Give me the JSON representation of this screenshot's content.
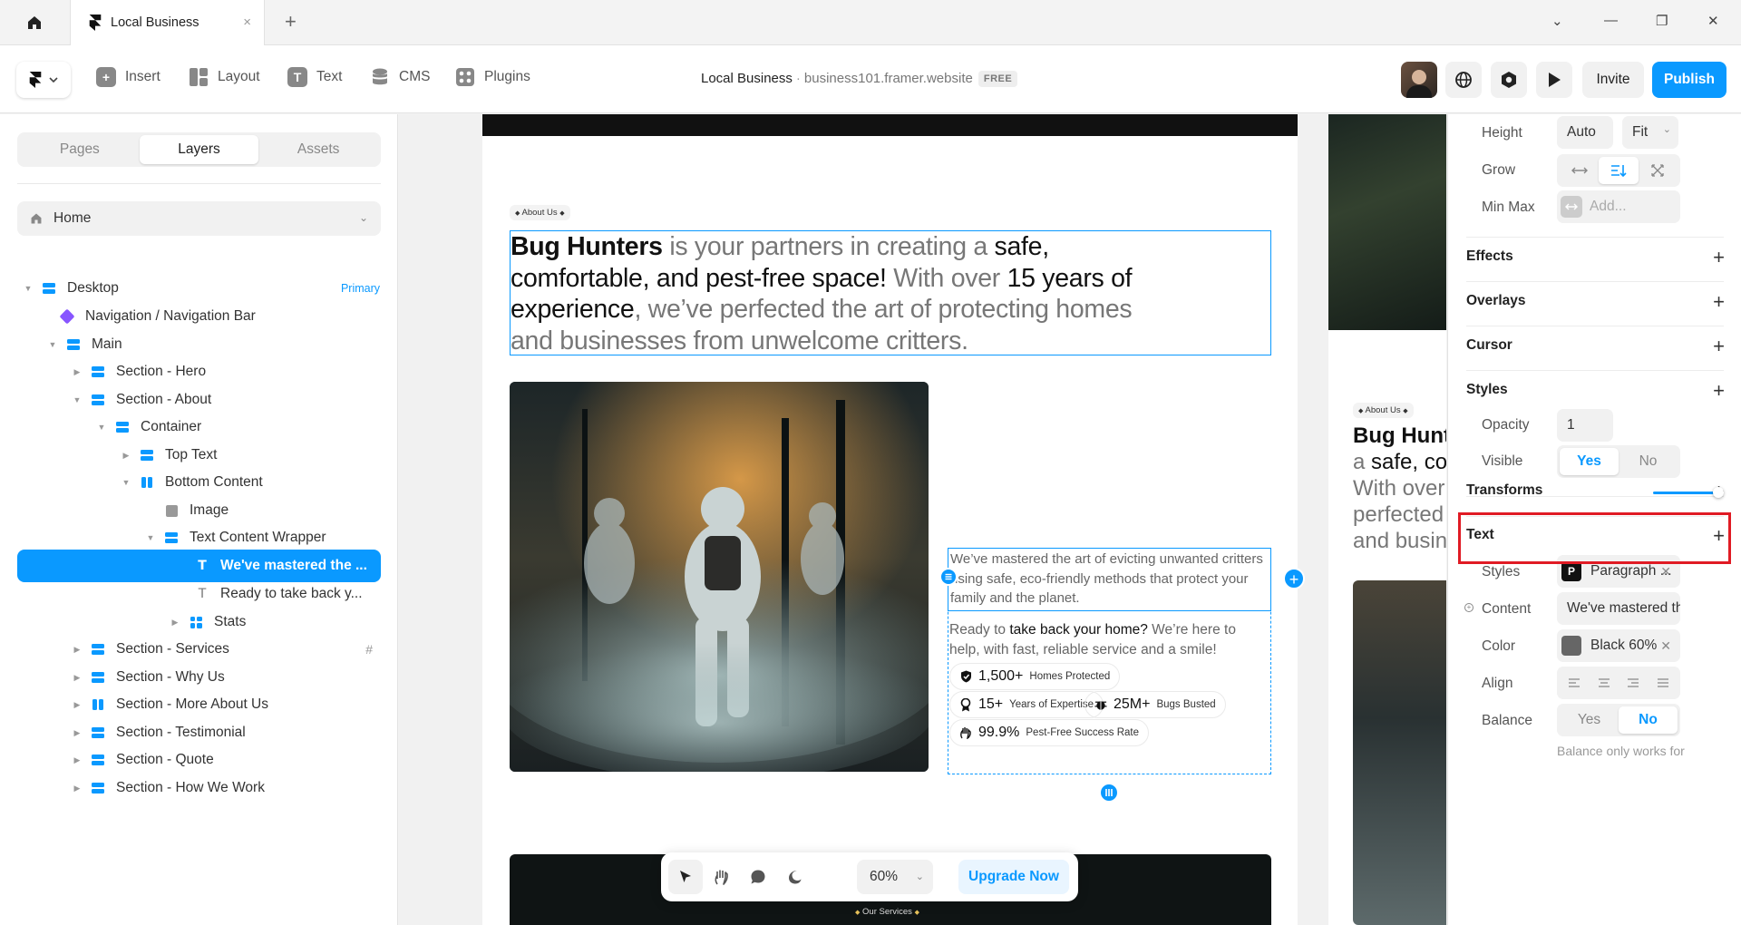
{
  "window": {
    "tab_title": "Local Business",
    "close_glyph": "×",
    "new_tab_glyph": "+",
    "controls": {
      "dropdown": "⌄",
      "minimize": "—",
      "restore": "❐",
      "close": "✕"
    }
  },
  "toolbar": {
    "tools": [
      {
        "label": "Insert",
        "icon": "plus-square-icon"
      },
      {
        "label": "Layout",
        "icon": "layout-icon"
      },
      {
        "label": "Text",
        "icon": "text-icon"
      },
      {
        "label": "CMS",
        "icon": "database-icon"
      },
      {
        "label": "Plugins",
        "icon": "plugins-icon"
      }
    ],
    "project_name": "Local Business",
    "separator": "·",
    "domain": "business101.framer.website",
    "plan_badge": "FREE",
    "invite_label": "Invite",
    "publish_label": "Publish"
  },
  "left_panel": {
    "tabs": [
      "Pages",
      "Layers",
      "Assets"
    ],
    "active_tab": "Layers",
    "page_select": "Home",
    "layers": [
      {
        "label": "Desktop",
        "tag": "Primary"
      },
      {
        "label": "Navigation / Navigation Bar"
      },
      {
        "label": "Main"
      },
      {
        "label": "Section - Hero"
      },
      {
        "label": "Section - About"
      },
      {
        "label": "Container"
      },
      {
        "label": "Top Text"
      },
      {
        "label": "Bottom Content"
      },
      {
        "label": "Image"
      },
      {
        "label": "Text Content Wrapper"
      },
      {
        "label": "We've mastered the ...",
        "selected": true
      },
      {
        "label": "Ready to take back y..."
      },
      {
        "label": "Stats"
      },
      {
        "label": "Section - Services",
        "tag": "#"
      },
      {
        "label": "Section - Why Us"
      },
      {
        "label": "Section - More About Us"
      },
      {
        "label": "Section - Testimonial"
      },
      {
        "label": "Section - Quote"
      },
      {
        "label": "Section - How We Work"
      }
    ]
  },
  "canvas": {
    "about_tag": "About Us",
    "headline": {
      "p1": "Bug Hunters",
      "p2": " is your partners in creating a ",
      "p3": "safe, comfortable, and pest-free space!",
      "p4": " With over ",
      "p5": "15 years of experience",
      "p6": ", we’ve perfected the art of protecting homes and businesses from unwelcome critters."
    },
    "mastered_text": "We’ve mastered the art of evicting unwanted critters using safe, eco-friendly methods that protect your family and the planet.",
    "ready": {
      "p1": "Ready to ",
      "p2": "take back your home?",
      "p3": " We’re here to help, with fast, reliable service and a smile!"
    },
    "stats": [
      {
        "value": "1,500+",
        "label": "Homes Protected",
        "icon": "shield-check-icon"
      },
      {
        "value": "15+",
        "label": "Years of Expertise",
        "icon": "award-icon"
      },
      {
        "value": "25M+",
        "label": "Bugs Busted",
        "icon": "bug-icon"
      },
      {
        "value": "99.9%",
        "label": "Pest-Free Success Rate",
        "icon": "hand-sparkle-icon"
      }
    ],
    "services_tag": "Our Services",
    "side_preview": {
      "about_tag": "About Us",
      "l1": "Bug Hunt",
      "l2a": "a ",
      "l2b": "safe, co",
      "l3": "With over",
      "l4": "perfected",
      "l5": "and busin"
    },
    "floating_bar": {
      "zoom": "60%",
      "upgrade_label": "Upgrade Now"
    }
  },
  "right_panel": {
    "height": {
      "label": "Height",
      "value": "Auto",
      "mode": "Fit"
    },
    "grow_label": "Grow",
    "minmax": {
      "label": "Min Max",
      "placeholder": "Add..."
    },
    "sections": {
      "effects": "Effects",
      "overlays": "Overlays",
      "cursor": "Cursor",
      "styles": "Styles",
      "transforms": "Transforms",
      "text": "Text"
    },
    "opacity": {
      "label": "Opacity",
      "value": "1"
    },
    "visible": {
      "label": "Visible",
      "yes": "Yes",
      "no": "No",
      "selected": "Yes"
    },
    "text_styles": {
      "label": "Styles",
      "badge": "P",
      "value": "Paragraph ..."
    },
    "content": {
      "label": "Content",
      "value": "We've mastered th..."
    },
    "color": {
      "label": "Color",
      "value": "Black 60%"
    },
    "align_label": "Align",
    "balance": {
      "label": "Balance",
      "yes": "Yes",
      "no": "No",
      "selected": "No",
      "note": "Balance only works for"
    }
  },
  "colors": {
    "accent": "#0a99ff",
    "highlight_box": "#e01b24"
  }
}
